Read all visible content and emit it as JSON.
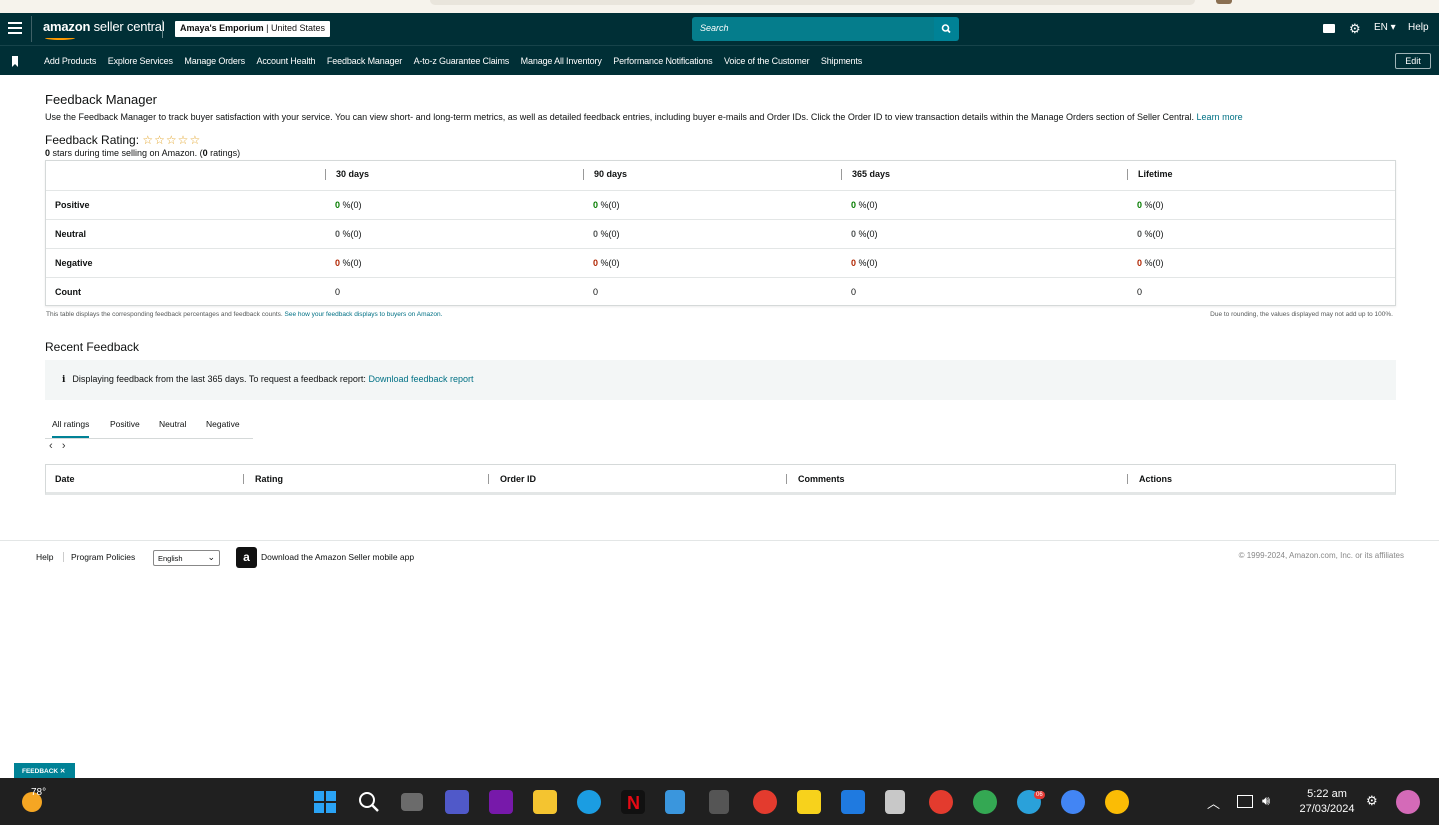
{
  "header": {
    "logo_bold": "amazon",
    "logo_rest": " seller central",
    "store_name": "Amaya's Emporium",
    "store_country": "United States",
    "search_placeholder": "Search",
    "lang": "EN ▾",
    "help": "Help"
  },
  "nav": {
    "items": [
      "Add Products",
      "Explore Services",
      "Manage Orders",
      "Account Health",
      "Feedback Manager",
      "A-to-z Guarantee Claims",
      "Manage All Inventory",
      "Performance Notifications",
      "Voice of the Customer",
      "Shipments"
    ],
    "edit": "Edit"
  },
  "page": {
    "title": "Feedback Manager",
    "description": "Use the Feedback Manager to track buyer satisfaction with your service. You can view short- and long-term metrics, as well as detailed feedback entries, including buyer e-mails and Order IDs. Click the Order ID to view transaction details within the Manage Orders section of Seller Central.",
    "learn_more": "Learn more",
    "rating_label": "Feedback Rating:",
    "stars": "☆☆☆☆☆",
    "rating_sub_bold": "0",
    "rating_sub_text": " stars during time selling on Amazon. (",
    "rating_sub_count": "0",
    "rating_sub_end": " ratings)"
  },
  "feedback_table": {
    "columns": [
      "30 days",
      "90 days",
      "365 days",
      "Lifetime"
    ],
    "rows": {
      "positive": {
        "label": "Positive",
        "values": [
          "0",
          "0",
          "0",
          "0"
        ],
        "suffix": " %(0)"
      },
      "neutral": {
        "label": "Neutral",
        "values": [
          "0",
          "0",
          "0",
          "0"
        ],
        "suffix": " %(0)"
      },
      "negative": {
        "label": "Negative",
        "values": [
          "0",
          "0",
          "0",
          "0"
        ],
        "suffix": " %(0)"
      },
      "count": {
        "label": "Count",
        "values": [
          "0",
          "0",
          "0",
          "0"
        ]
      }
    },
    "note_left": "This table displays the corresponding feedback percentages and feedback counts.",
    "note_left_link": "See how your feedback displays to buyers on Amazon.",
    "note_right": "Due to rounding, the values displayed may not add up to 100%."
  },
  "recent": {
    "title": "Recent Feedback",
    "info_icon": "i",
    "info_text": "Displaying feedback from the last 365 days. To request a feedback report:",
    "info_link": "Download feedback report",
    "tabs": [
      "All ratings",
      "Positive",
      "Neutral",
      "Negative"
    ],
    "columns": [
      "Date",
      "Rating",
      "Order ID",
      "Comments",
      "Actions"
    ]
  },
  "footer": {
    "help": "Help",
    "program_policies": "Program Policies",
    "language": "English",
    "app_letter": "a",
    "app_text": "Download the Amazon Seller mobile app",
    "copyright": "© 1999-2024, Amazon.com, Inc. or its affiliates"
  },
  "feedback_tab": "FEEDBACK ✕",
  "taskbar": {
    "temperature": "78°",
    "time": "5:22 am",
    "date": "27/03/2024",
    "telegram_badge": "06"
  }
}
